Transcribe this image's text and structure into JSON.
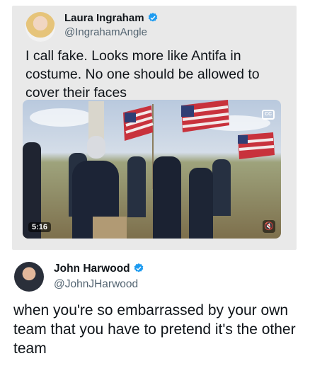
{
  "quoted_tweet": {
    "author_name": "Laura Ingraham",
    "handle": "@IngrahamAngle",
    "verified_icon": "verified-badge-icon",
    "text": "I call fake.  Looks more like Antifa in costume.  No one should be allowed to cover their faces",
    "video": {
      "duration": "5:16",
      "cc_label": "CC",
      "mute_icon": "volume-muted-icon"
    }
  },
  "reply_tweet": {
    "author_name": "John Harwood",
    "handle": "@JohnJHarwood",
    "verified_icon": "verified-badge-icon",
    "text": "when you're so embarrassed by your own team that you have to pretend it's the other team"
  },
  "colors": {
    "verified_blue": "#1d9bf0",
    "quote_background": "#e9e9e9",
    "handle_gray": "#536471"
  }
}
